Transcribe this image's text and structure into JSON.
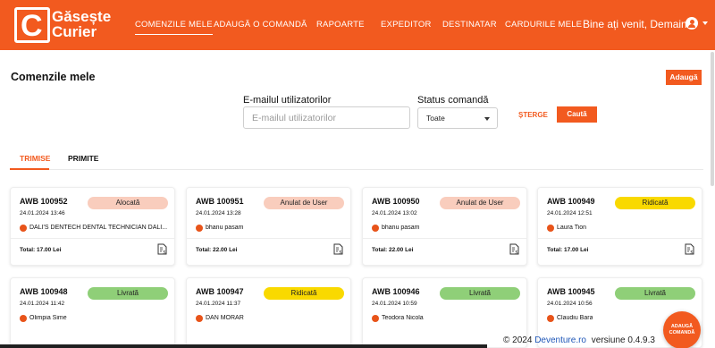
{
  "brand": {
    "logo_letter": "C",
    "name_line1": "Găsește",
    "name_line2": "Curier"
  },
  "nav": [
    {
      "label": "COMENZILE MELE"
    },
    {
      "label": "ADAUGĂ O COMANDĂ"
    },
    {
      "label": "RAPOARTE"
    },
    {
      "label": "EXPEDITOR"
    },
    {
      "label": "DESTINATAR"
    },
    {
      "label": "CARDURILE MELE"
    }
  ],
  "header": {
    "welcome": "Bine ați venit, Demain",
    "user_icon": "user-circle-icon"
  },
  "page": {
    "title": "Comenzile mele",
    "add_button": "Adaugă"
  },
  "filters": {
    "email_label": "E-mailul utilizatorilor",
    "email_placeholder": "E-mailul utilizatorilor",
    "status_label": "Status comandă",
    "status_value": "Toate",
    "clear": "ȘTERGE",
    "search": "Caută"
  },
  "tabs": [
    {
      "label": "TRIMISE"
    },
    {
      "label": "PRIMITE"
    }
  ],
  "orders": [
    {
      "awb": "AWB 100952",
      "date": "24.01.2024 13:46",
      "status": "Alocată",
      "person": "DALI'S DENTECH DENTAL TECHNICIAN DALI...",
      "total": "Total: 17.00 Lei"
    },
    {
      "awb": "AWB 100951",
      "date": "24.01.2024 13:28",
      "status": "Anulat de User",
      "person": "bhanu pasam",
      "total": "Total: 22.00 Lei"
    },
    {
      "awb": "AWB 100950",
      "date": "24.01.2024 13:02",
      "status": "Anulat de User",
      "person": "bhanu pasam",
      "total": "Total: 22.00 Lei"
    },
    {
      "awb": "AWB 100949",
      "date": "24.01.2024 12:51",
      "status": "Ridicată",
      "person": "Laura Tion",
      "total": "Total: 17.00 Lei"
    },
    {
      "awb": "AWB 100948",
      "date": "24.01.2024 11:42",
      "status": "Livrată",
      "person": "Olimpia Sime",
      "total": ""
    },
    {
      "awb": "AWB 100947",
      "date": "24.01.2024 11:37",
      "status": "Ridicată",
      "person": "DAN MORAR",
      "total": ""
    },
    {
      "awb": "AWB 100946",
      "date": "24.01.2024 10:59",
      "status": "Livrată",
      "person": "Teodora Nicola",
      "total": ""
    },
    {
      "awb": "AWB 100945",
      "date": "24.01.2024 10:56",
      "status": "Livrată",
      "person": "Claudiu Bara",
      "total": ""
    }
  ],
  "status_colors": {
    "Alocată": "#f9cdbd",
    "Anulat de User": "#f9cdbd",
    "Ridicată": "#f9d900",
    "Livrată": "#8fcf78"
  },
  "footer": {
    "copyright": "© 2024",
    "link": "Deventure.ro",
    "version": "versiune 0.4.9.3"
  },
  "fab": {
    "line1": "ADAUGĂ",
    "line2": "COMANDĂ"
  },
  "colors": {
    "brand": "#f25a1f",
    "link": "#1f57b8"
  }
}
